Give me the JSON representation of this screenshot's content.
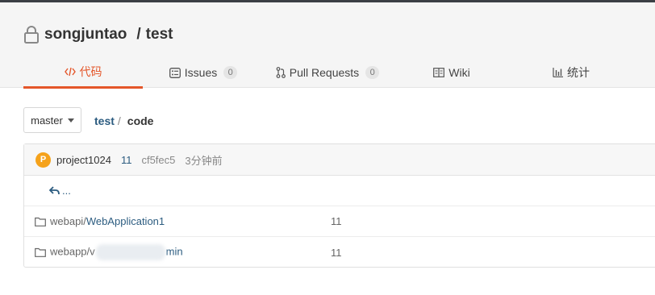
{
  "repo": {
    "owner": "songjuntao",
    "separator": "/",
    "name": "test"
  },
  "tabs": [
    {
      "label": "代码",
      "icon": "code-icon",
      "active": true
    },
    {
      "label": "Issues",
      "badge": "0",
      "icon": "issues-icon"
    },
    {
      "label": "Pull Requests",
      "badge": "0",
      "icon": "pull-request-icon"
    },
    {
      "label": "Wiki",
      "icon": "wiki-icon"
    },
    {
      "label": "统计",
      "icon": "stats-icon"
    }
  ],
  "branch": {
    "label": "master"
  },
  "breadcrumb": {
    "root": "test",
    "separator": "/",
    "current": "code"
  },
  "commit": {
    "avatar_letter": "P",
    "author": "project1024",
    "message": "11",
    "hash": "cf5fec5",
    "time": "3分钟前"
  },
  "back": {
    "label": "..."
  },
  "files": [
    {
      "prefix": "webapi/",
      "name": "WebApplication1",
      "message": "11"
    },
    {
      "prefix": "webapp/v",
      "name_suffix": "min",
      "message": "11"
    }
  ],
  "colors": {
    "accent": "#e4562a",
    "link": "#2c5c80",
    "avatar": "#f5a21b"
  }
}
